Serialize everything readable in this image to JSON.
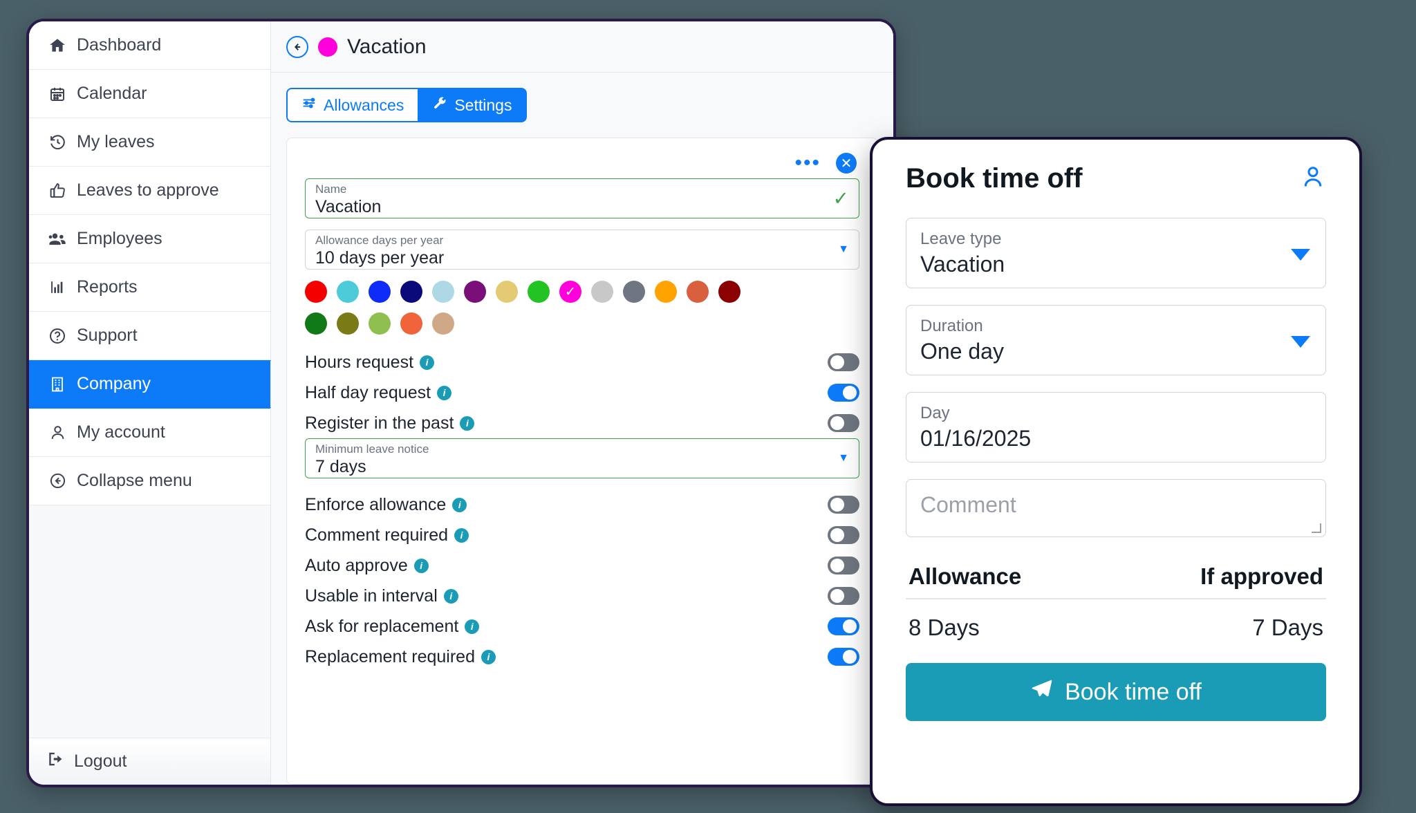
{
  "sidebar": {
    "items": [
      {
        "label": "Dashboard",
        "icon": "home-icon",
        "active": false
      },
      {
        "label": "Calendar",
        "icon": "calendar-icon",
        "active": false
      },
      {
        "label": "My leaves",
        "icon": "history-icon",
        "active": false
      },
      {
        "label": "Leaves to approve",
        "icon": "thumbs-up-icon",
        "active": false
      },
      {
        "label": "Employees",
        "icon": "users-icon",
        "active": false
      },
      {
        "label": "Reports",
        "icon": "bar-chart-icon",
        "active": false
      },
      {
        "label": "Support",
        "icon": "question-circle-icon",
        "active": false
      },
      {
        "label": "Company",
        "icon": "building-icon",
        "active": true
      },
      {
        "label": "My account",
        "icon": "user-icon",
        "active": false
      },
      {
        "label": "Collapse menu",
        "icon": "arrow-left-circle-icon",
        "active": false
      }
    ],
    "logout": {
      "label": "Logout",
      "icon": "logout-icon"
    }
  },
  "panel": {
    "back_icon": "arrow-left-circle-icon",
    "title": "Vacation",
    "title_dot_color": "#ff00dd",
    "tabs": [
      {
        "label": "Allowances",
        "icon": "sliders-icon",
        "active": false
      },
      {
        "label": "Settings",
        "icon": "wrench-icon",
        "active": true
      }
    ],
    "card_tools": {
      "more_icon": "more-horizontal-icon",
      "close_icon": "close-circle-icon"
    },
    "fields": {
      "name": {
        "label": "Name",
        "value": "Vacation",
        "valid_icon": "check-icon"
      },
      "allowance": {
        "label": "Allowance days per year",
        "value": "10 days per year",
        "caret_icon": "chevron-down-icon"
      },
      "notice": {
        "label": "Minimum leave notice",
        "value": "7 days",
        "caret_icon": "chevron-down-icon"
      }
    },
    "colors": [
      "#f40000",
      "#4ecbd9",
      "#0f2bf7",
      "#0a0a7a",
      "#aed8e6",
      "#7a0f7a",
      "#e3ca73",
      "#22c322",
      "#ff00dd",
      "#c8c8c8",
      "#6f7681",
      "#ffa300",
      "#d9603f",
      "#8b0000",
      "#0f7a17",
      "#7a7a17",
      "#8fbf4f",
      "#f0643c",
      "#cfa987"
    ],
    "selected_color": "#ff00dd",
    "selected_color_index": 8,
    "toggles": [
      {
        "label": "Hours request",
        "on": false
      },
      {
        "label": "Half day request",
        "on": true
      },
      {
        "label": "Register in the past",
        "on": false
      },
      {
        "label": "Enforce allowance",
        "on": false
      },
      {
        "label": "Comment required",
        "on": false
      },
      {
        "label": "Auto approve",
        "on": false
      },
      {
        "label": "Usable in interval",
        "on": false
      },
      {
        "label": "Ask for replacement",
        "on": true
      },
      {
        "label": "Replacement required",
        "on": true
      }
    ]
  },
  "modal": {
    "title": "Book time off",
    "person_icon": "user-icon",
    "fields": [
      {
        "label": "Leave type",
        "value": "Vacation",
        "caret_icon": "chevron-down-icon"
      },
      {
        "label": "Duration",
        "value": "One day",
        "caret_icon": "chevron-down-icon"
      },
      {
        "label": "Day",
        "value": "01/16/2025",
        "caret_icon": ""
      }
    ],
    "comment": {
      "placeholder": "Comment",
      "value": ""
    },
    "summary": {
      "allowance_header": "Allowance",
      "if_approved_header": "If approved",
      "allowance_value": "8 Days",
      "if_approved_value": "7 Days"
    },
    "submit": {
      "label": "Book time off",
      "icon": "paper-plane-icon",
      "color": "#1a9cb7"
    }
  }
}
